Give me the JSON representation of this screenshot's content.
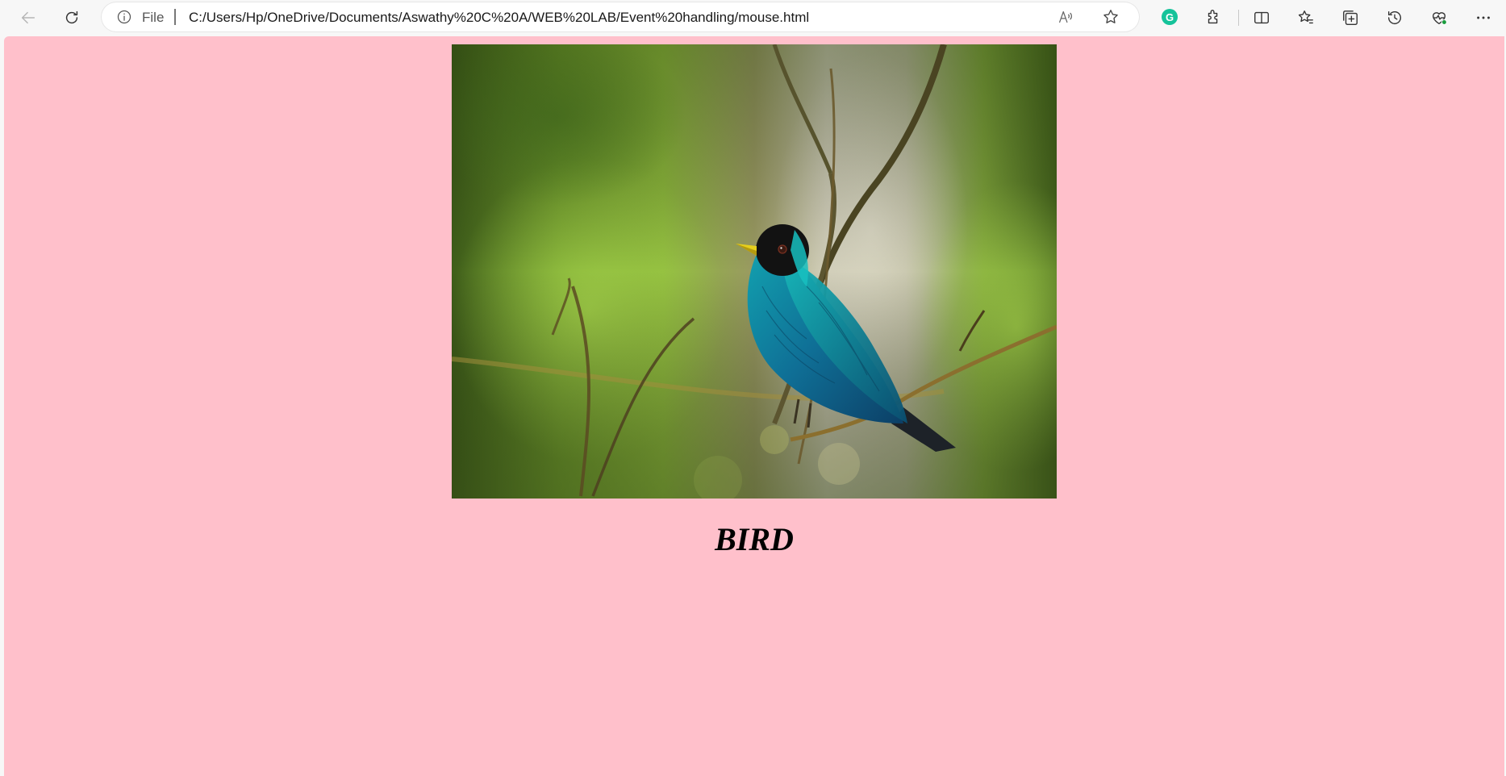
{
  "browser": {
    "address_bar": {
      "protocol_label": "File",
      "url": "C:/Users/Hp/OneDrive/Documents/Aswathy%20C%20A/WEB%20LAB/Event%20handling/mouse.html"
    },
    "extension_letter": "G"
  },
  "page": {
    "background_color": "#ffc0cb",
    "heading": "BIRD"
  }
}
